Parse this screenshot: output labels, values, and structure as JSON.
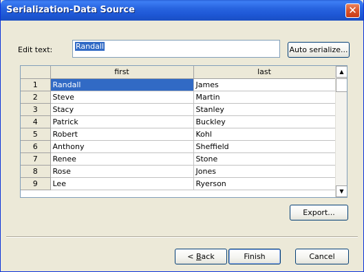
{
  "window": {
    "title": "Serialization-Data Source",
    "close_label": "✕"
  },
  "edit": {
    "label": "Edit text:",
    "value": "Randall"
  },
  "buttons": {
    "auto_serialize": "Auto serialize...",
    "export": "Export...",
    "back_prefix": "< ",
    "back_mnemonic": "B",
    "back_rest": "ack",
    "finish": "Finish",
    "cancel": "Cancel"
  },
  "table": {
    "columns": [
      "first",
      "last"
    ],
    "rows": [
      {
        "n": "1",
        "first": "Randall",
        "last": "James"
      },
      {
        "n": "2",
        "first": "Steve",
        "last": "Martin"
      },
      {
        "n": "3",
        "first": "Stacy",
        "last": "Stanley"
      },
      {
        "n": "4",
        "first": "Patrick",
        "last": "Buckley"
      },
      {
        "n": "5",
        "first": "Robert",
        "last": "Kohl"
      },
      {
        "n": "6",
        "first": "Anthony",
        "last": "Sheffield"
      },
      {
        "n": "7",
        "first": "Renee",
        "last": "Stone"
      },
      {
        "n": "8",
        "first": "Rose",
        "last": "Jones"
      },
      {
        "n": "9",
        "first": "Lee",
        "last": "Ryerson"
      }
    ],
    "selected_row": 0
  },
  "scrollbar": {
    "up_icon": "arrow-up-icon",
    "down_icon": "arrow-down-icon"
  }
}
